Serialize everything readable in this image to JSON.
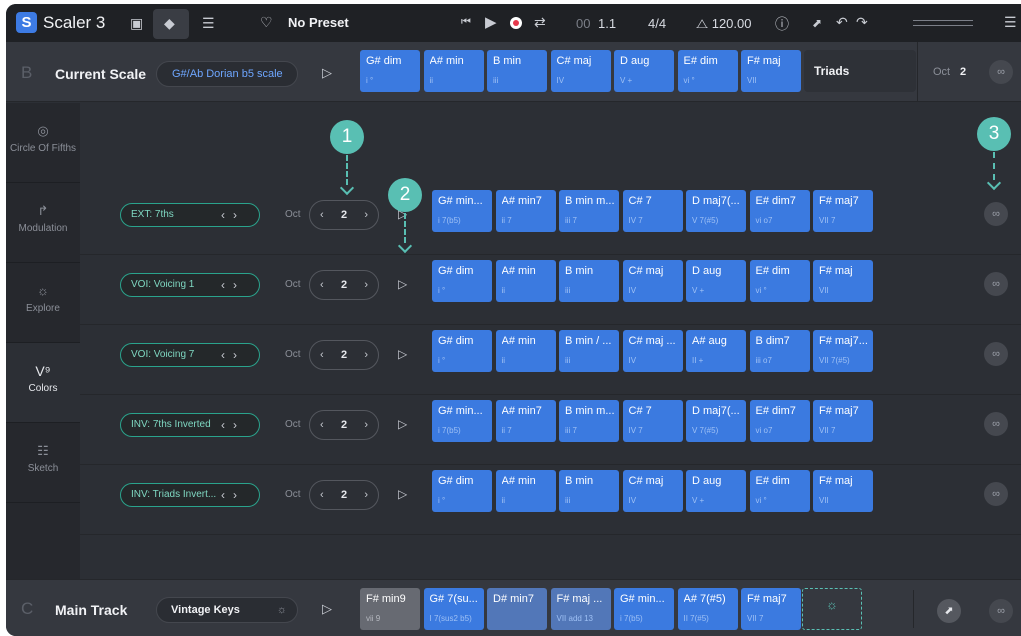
{
  "topbar": {
    "logo_letter": "S",
    "app_title": "Scaler 3",
    "preset_name": "No Preset",
    "position_prefix": "00",
    "position_value": "1.1",
    "time_signature": "4/4",
    "tempo": "120.00",
    "tempo_icon": "metronome-icon"
  },
  "scale_row": {
    "letter": "B",
    "name": "Current Scale",
    "scale": "G#/Ab Dorian b5 scale",
    "mode": "Triads",
    "oct_label": "Oct",
    "oct_value": "2",
    "chords": [
      {
        "name": "G# dim",
        "roman": "i °"
      },
      {
        "name": "A# min",
        "roman": "ii"
      },
      {
        "name": "B min",
        "roman": "iii"
      },
      {
        "name": "C# maj",
        "roman": "IV"
      },
      {
        "name": "D aug",
        "roman": "V +"
      },
      {
        "name": "E# dim",
        "roman": "vi °"
      },
      {
        "name": "F# maj",
        "roman": "VII"
      }
    ]
  },
  "sidebar": {
    "items": [
      {
        "icon": "circle-of-fifths-icon",
        "label": "Circle Of Fifths"
      },
      {
        "icon": "modulation-icon",
        "label": "Modulation"
      },
      {
        "icon": "explore-bulb-icon",
        "label": "Explore"
      },
      {
        "icon": "colors-icon",
        "label": "Colors",
        "glyph": "V⁹"
      },
      {
        "icon": "sketch-icon",
        "label": "Sketch"
      }
    ]
  },
  "rows": [
    {
      "variation": "EXT: 7ths",
      "oct_label": "Oct",
      "oct": "2",
      "chords": [
        {
          "name": "G# min...",
          "roman": "i 7(b5)"
        },
        {
          "name": "A# min7",
          "roman": "ii 7"
        },
        {
          "name": "B min m...",
          "roman": "iii 7"
        },
        {
          "name": "C# 7",
          "roman": "IV 7"
        },
        {
          "name": "D maj7(...",
          "roman": "V 7(#5)"
        },
        {
          "name": "E# dim7",
          "roman": "vi o7"
        },
        {
          "name": "F# maj7",
          "roman": "VII 7"
        }
      ]
    },
    {
      "variation": "VOI: Voicing 1",
      "oct_label": "Oct",
      "oct": "2",
      "chords": [
        {
          "name": "G# dim",
          "roman": "i °"
        },
        {
          "name": "A# min",
          "roman": "ii"
        },
        {
          "name": "B min",
          "roman": "iii"
        },
        {
          "name": "C# maj",
          "roman": "IV"
        },
        {
          "name": "D aug",
          "roman": "V +"
        },
        {
          "name": "E# dim",
          "roman": "vi °"
        },
        {
          "name": "F# maj",
          "roman": "VII"
        }
      ]
    },
    {
      "variation": "VOI: Voicing 7",
      "oct_label": "Oct",
      "oct": "2",
      "chords": [
        {
          "name": "G# dim",
          "roman": "i °"
        },
        {
          "name": "A# min",
          "roman": "ii"
        },
        {
          "name": "B min / ...",
          "roman": "iii"
        },
        {
          "name": "C# maj ...",
          "roman": "IV"
        },
        {
          "name": "A# aug",
          "roman": "II +"
        },
        {
          "name": "B dim7",
          "roman": "iii o7"
        },
        {
          "name": "F# maj7...",
          "roman": "VII 7(#5)"
        }
      ]
    },
    {
      "variation": "INV: 7ths Inverted",
      "oct_label": "Oct",
      "oct": "2",
      "chords": [
        {
          "name": "G# min...",
          "roman": "i 7(b5)"
        },
        {
          "name": "A# min7",
          "roman": "ii 7"
        },
        {
          "name": "B min m...",
          "roman": "iii 7"
        },
        {
          "name": "C# 7",
          "roman": "IV 7"
        },
        {
          "name": "D maj7(...",
          "roman": "V 7(#5)"
        },
        {
          "name": "E# dim7",
          "roman": "vi o7"
        },
        {
          "name": "F# maj7",
          "roman": "VII 7"
        }
      ]
    },
    {
      "variation": "INV: Triads Invert...",
      "oct_label": "Oct",
      "oct": "2",
      "chords": [
        {
          "name": "G# dim",
          "roman": "i °"
        },
        {
          "name": "A# min",
          "roman": "ii"
        },
        {
          "name": "B min",
          "roman": "iii"
        },
        {
          "name": "C# maj",
          "roman": "IV"
        },
        {
          "name": "D aug",
          "roman": "V +"
        },
        {
          "name": "E# dim",
          "roman": "vi °"
        },
        {
          "name": "F# maj",
          "roman": "VII"
        }
      ]
    }
  ],
  "markers": [
    "1",
    "2",
    "3"
  ],
  "track_row": {
    "letter": "C",
    "name": "Main Track",
    "instrument": "Vintage Keys",
    "chords": [
      {
        "name": "F# min9",
        "roman": "vii 9",
        "style": "gray"
      },
      {
        "name": "G# 7(su...",
        "roman": "I 7(sus2 b5)",
        "style": "blue"
      },
      {
        "name": "D# min7",
        "roman": "",
        "style": "mid"
      },
      {
        "name": "F# maj ...",
        "roman": "VII add 13",
        "style": "mid"
      },
      {
        "name": "G# min...",
        "roman": "i 7(b5)",
        "style": "blue"
      },
      {
        "name": "A# 7(#5)",
        "roman": "II 7(#5)",
        "style": "blue"
      },
      {
        "name": "F# maj7",
        "roman": "VII 7",
        "style": "blue"
      }
    ]
  },
  "colors": {
    "accent_blue": "#3b7ae0",
    "teal": "#59bfb3",
    "background": "#2c2f35",
    "topbar": "#1f2125"
  }
}
